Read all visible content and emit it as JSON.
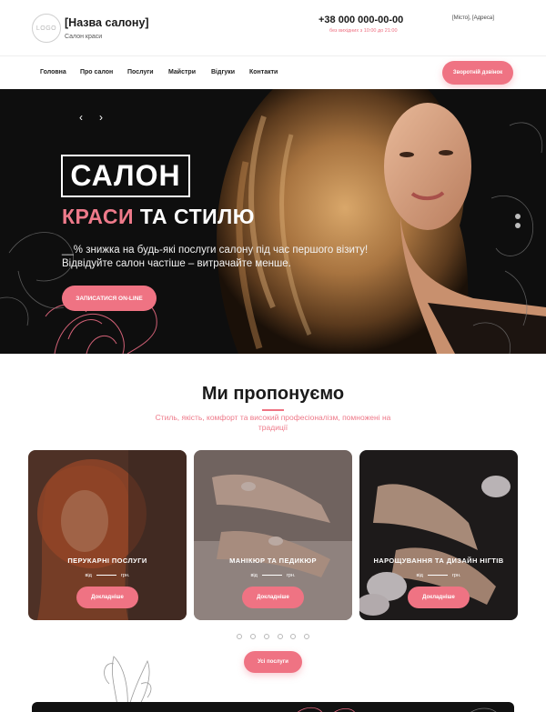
{
  "header": {
    "logo": "LOGO",
    "salon_name": "[Назва салону]",
    "salon_sub": "Салон краси",
    "phone": "+38 000 000-00-00",
    "hours": "без вихідних з 10:00 до 21:00",
    "address": "[Місто], [Адреса]"
  },
  "nav": {
    "items": [
      "Головна",
      "Про салон",
      "Послуги",
      "Майстри",
      "Відгуки",
      "Контакти"
    ],
    "callback": "Зворотній дзвінок"
  },
  "hero": {
    "prev": "‹",
    "next": "›",
    "title": "САЛОН",
    "subtitle_accent": "КРАСИ",
    "subtitle_rest": " ТА СТИЛЮ",
    "promo_line1": "__% знижка на будь-які послуги салону під час першого візиту!",
    "promo_line2": "Відвідуйте салон частіше – витрачайте менше.",
    "cta": "ЗАПИСАТИСЯ ON-LINE"
  },
  "offer": {
    "title": "Ми пропонуємо",
    "subtitle": "Стиль, якість, комфорт та високий професіоналізм, помножені на традиції",
    "cards": [
      {
        "title": "ПЕРУКАРНІ ПОСЛУГИ",
        "from": "від",
        "currency": "грн.",
        "more": "Докладніше"
      },
      {
        "title": "МАНІКЮР ТА ПЕДИКЮР",
        "from": "від",
        "currency": "грн.",
        "more": "Докладніше"
      },
      {
        "title": "НАРОЩУВАННЯ ТА ДИЗАЙН НІГТІВ",
        "from": "від",
        "currency": "грн.",
        "more": "Докладніше"
      }
    ],
    "all_services": "Усі послуги"
  },
  "colors": {
    "accent": "#ef7383",
    "dark": "#0e0e0e"
  }
}
